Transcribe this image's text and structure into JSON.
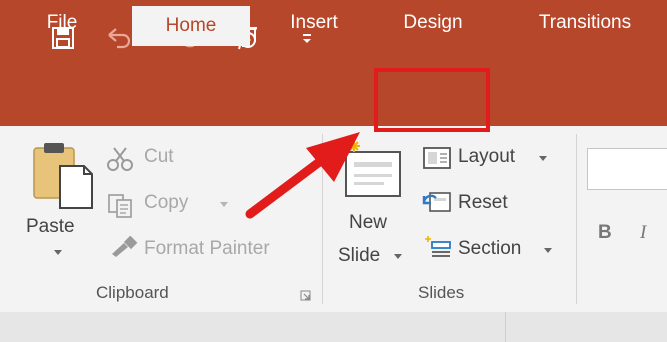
{
  "quick_access": {
    "save_icon": "save-icon",
    "undo_icon": "undo-icon",
    "redo_icon": "redo-icon",
    "present_icon": "present-from-beginning-icon",
    "customize_icon": "customize-qat-icon"
  },
  "tabs": [
    {
      "label": "File"
    },
    {
      "label": "Home"
    },
    {
      "label": "Insert"
    },
    {
      "label": "Design"
    },
    {
      "label": "Transitions"
    }
  ],
  "active_tab": "Home",
  "clipboard": {
    "paste_label": "Paste",
    "cut_label": "Cut",
    "copy_label": "Copy",
    "format_painter_label": "Format Painter",
    "group_label": "Clipboard"
  },
  "slides": {
    "new_slide_line1": "New",
    "new_slide_line2": "Slide",
    "layout_label": "Layout",
    "reset_label": "Reset",
    "section_label": "Section",
    "group_label": "Slides"
  },
  "font": {
    "bold_label": "B",
    "italic_label": "I"
  },
  "colors": {
    "accent": "#b7472a",
    "highlight": "#e21b1b",
    "ribbon_bg": "#f3f3f3"
  }
}
